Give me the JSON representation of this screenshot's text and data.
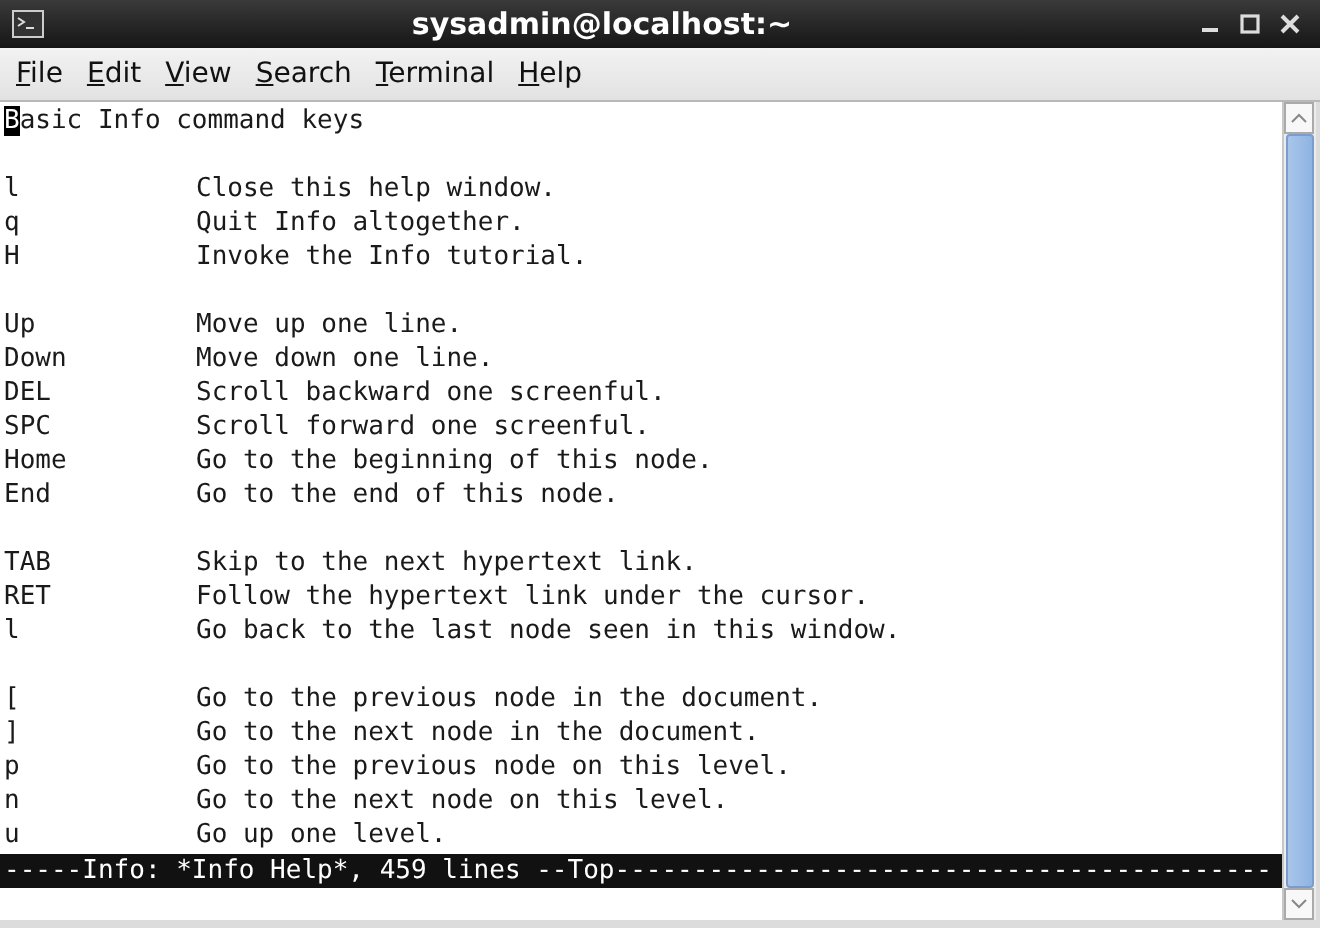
{
  "window": {
    "title": "sysadmin@localhost:~"
  },
  "menu": [
    {
      "label": "File"
    },
    {
      "label": "Edit"
    },
    {
      "label": "View"
    },
    {
      "label": "Search"
    },
    {
      "label": "Terminal"
    },
    {
      "label": "Help"
    }
  ],
  "terminal": {
    "heading": "Basic Info command keys",
    "cursor_on_heading": true,
    "groups": [
      [
        {
          "key": "l",
          "description": "Close this help window."
        },
        {
          "key": "q",
          "description": "Quit Info altogether."
        },
        {
          "key": "H",
          "description": "Invoke the Info tutorial."
        }
      ],
      [
        {
          "key": "Up",
          "description": "Move up one line."
        },
        {
          "key": "Down",
          "description": "Move down one line."
        },
        {
          "key": "DEL",
          "description": "Scroll backward one screenful."
        },
        {
          "key": "SPC",
          "description": "Scroll forward one screenful."
        },
        {
          "key": "Home",
          "description": "Go to the beginning of this node."
        },
        {
          "key": "End",
          "description": "Go to the end of this node."
        }
      ],
      [
        {
          "key": "TAB",
          "description": "Skip to the next hypertext link."
        },
        {
          "key": "RET",
          "description": "Follow the hypertext link under the cursor."
        },
        {
          "key": "l",
          "description": "Go back to the last node seen in this window."
        }
      ],
      [
        {
          "key": "[",
          "description": "Go to the previous node in the document."
        },
        {
          "key": "]",
          "description": "Go to the next node in the document."
        },
        {
          "key": "p",
          "description": "Go to the previous node on this level."
        },
        {
          "key": "n",
          "description": "Go to the next node on this level."
        },
        {
          "key": "u",
          "description": "Go up one level."
        }
      ]
    ],
    "status_line": "-----Info: *Info Help*, 459 lines --Top------------------------------------------"
  }
}
